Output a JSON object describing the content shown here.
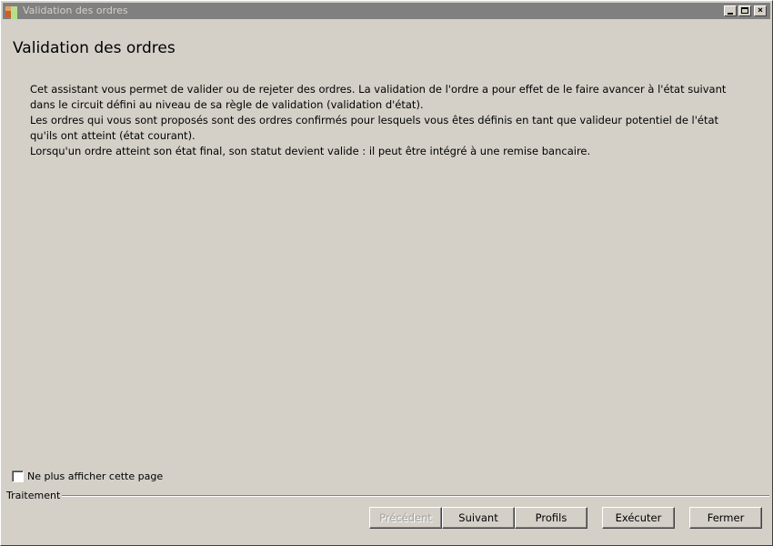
{
  "window": {
    "title": "Validation des ordres",
    "controls": {
      "minimize": "_",
      "maximize": "□",
      "close": "×"
    }
  },
  "header": {
    "title": "Validation des ordres"
  },
  "intro": {
    "lines": [
      "Cet assistant vous permet de valider ou de rejeter des ordres. La validation de l'ordre a pour effet de le faire avancer à l'état suivant",
      "dans le circuit défini au niveau de sa règle de validation (validation d'état).",
      "Les ordres qui vous sont proposés sont des ordres confirmés pour lesquels vous êtes définis en tant que valideur potentiel de l'état",
      "qu'ils ont atteint (état courant).",
      "Lorsqu'un ordre atteint son état final, son statut devient valide : il peut être intégré à une remise bancaire."
    ]
  },
  "options": {
    "hide_page_label": "Ne plus afficher cette page",
    "hide_page_checked": false
  },
  "footer": {
    "group_label": "Traitement",
    "buttons": {
      "previous": "Précédent",
      "next": "Suivant",
      "profiles": "Profils",
      "execute": "Exécuter",
      "close": "Fermer"
    }
  },
  "colors": {
    "background": "#d4d0c8",
    "titlebar": "#808080",
    "titlebar_text": "#d4d0c8",
    "disabled_text": "#a0a0a0"
  }
}
